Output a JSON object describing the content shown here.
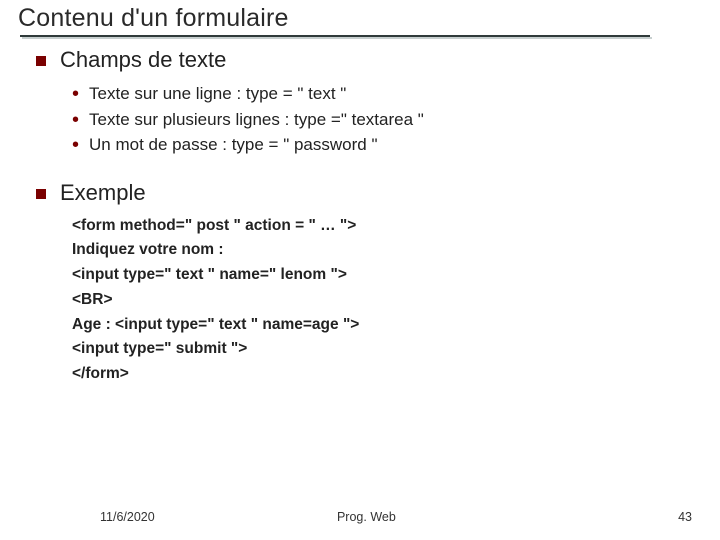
{
  "title": "Contenu d'un formulaire",
  "sections": [
    {
      "heading": "Champs de texte",
      "items": [
        "Texte sur une ligne : type = \" text \"",
        "Texte sur plusieurs lignes : type =\" textarea \"",
        "Un mot de passe : type = \" password \""
      ]
    },
    {
      "heading": "Exemple",
      "code": [
        "<form method=\" post \" action = \" … \">",
        "Indiquez votre nom :",
        "<input type=\" text \" name=\" lenom \">",
        "<BR>",
        "Age :  <input type=\" text \" name=age \">",
        "<input type=\" submit \">",
        "</form>"
      ]
    }
  ],
  "footer": {
    "date": "11/6/2020",
    "course": "Prog. Web",
    "page": "43"
  }
}
